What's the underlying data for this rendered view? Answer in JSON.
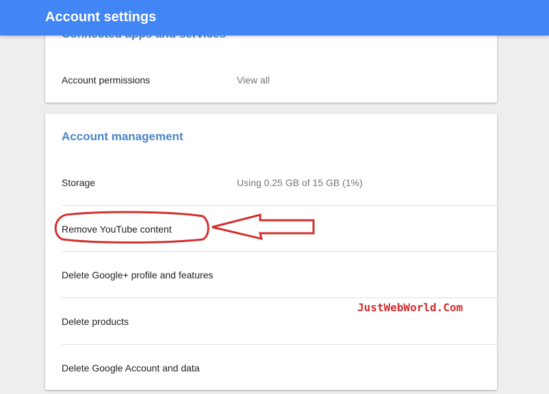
{
  "header": {
    "title": "Account settings"
  },
  "connected_apps": {
    "title": "Connected apps and services",
    "permissions_label": "Account permissions",
    "permissions_action": "View all"
  },
  "account_management": {
    "title": "Account management",
    "rows": [
      {
        "label": "Storage",
        "value": "Using 0.25 GB of 15 GB (1%)"
      },
      {
        "label": "Remove YouTube content"
      },
      {
        "label": "Delete Google+ profile and features"
      },
      {
        "label": "Delete products"
      },
      {
        "label": "Delete Google Account and data"
      }
    ]
  },
  "watermark": "JustWebWorld.Com",
  "colors": {
    "header_bg": "#4285f4",
    "section_title": "#4a86c8",
    "annotation_red": "#d32f2f",
    "page_bg": "#eeeeee"
  }
}
